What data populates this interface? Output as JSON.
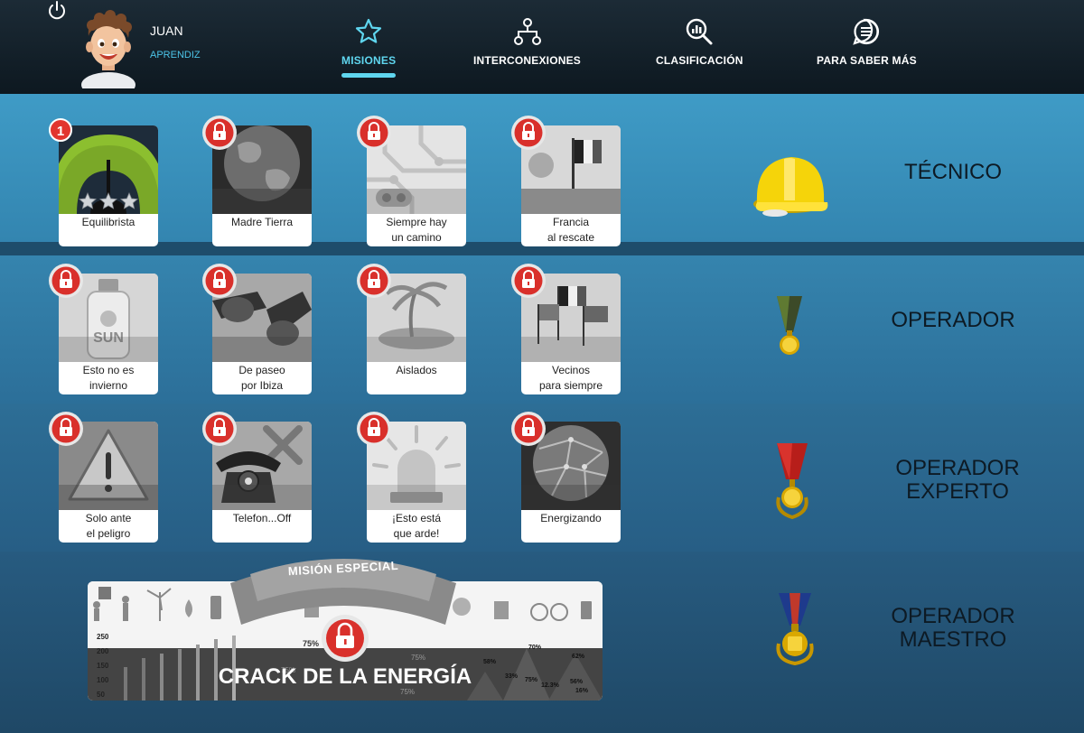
{
  "user": {
    "name": "JUAN",
    "rank": "APRENDIZ"
  },
  "tabs": [
    {
      "label": "MISIONES",
      "icon": "star-icon"
    },
    {
      "label": "INTERCONEXIONES",
      "icon": "network-icon"
    },
    {
      "label": "CLASIFICACIÓN",
      "icon": "ranking-search-icon"
    },
    {
      "label": "PARA SABER MÁS",
      "icon": "chat-list-icon"
    }
  ],
  "levels": [
    {
      "rank": [
        "TÉCNICO"
      ],
      "award": "helmet-icon",
      "missions": [
        {
          "line1": "Equilibrista",
          "line2": "",
          "locked": false,
          "badge": "1",
          "stars": 3
        },
        {
          "line1": "Madre Tierra",
          "line2": "",
          "locked": true
        },
        {
          "line1": "Siempre hay",
          "line2": "un camino",
          "locked": true
        },
        {
          "line1": "Francia",
          "line2": "al rescate",
          "locked": true
        }
      ]
    },
    {
      "rank": [
        "OPERADOR"
      ],
      "award": "green-medal-icon",
      "missions": [
        {
          "line1": "Esto no es",
          "line2": "invierno",
          "locked": true,
          "art_text": "SUN"
        },
        {
          "line1": "De paseo",
          "line2": "por Ibiza",
          "locked": true
        },
        {
          "line1": "Aislados",
          "line2": "",
          "locked": true
        },
        {
          "line1": "Vecinos",
          "line2": "para siempre",
          "locked": true
        }
      ]
    },
    {
      "rank": [
        "OPERADOR",
        "EXPERTO"
      ],
      "award": "red-medal-icon",
      "missions": [
        {
          "line1": "Solo ante",
          "line2": "el peligro",
          "locked": true
        },
        {
          "line1": "Telefon...Off",
          "line2": "",
          "locked": true
        },
        {
          "line1": "¡Esto está",
          "line2": "que arde!",
          "locked": true
        },
        {
          "line1": "Energizando",
          "line2": "",
          "locked": true
        }
      ]
    },
    {
      "rank": [
        "OPERADOR",
        "MAESTRO"
      ],
      "award": "blue-medal-icon"
    }
  ],
  "special": {
    "ribbon": "MISIÓN ESPECIAL",
    "title": "CRACK DE LA ENERGÍA",
    "axis_ticks": [
      "250",
      "200",
      "150",
      "100",
      "50"
    ],
    "percent_labels": [
      "75%",
      "75%",
      "75%",
      "75%",
      "70%",
      "62%",
      "58%",
      "33%",
      "75%",
      "12.3%",
      "56%",
      "16%"
    ]
  },
  "colors": {
    "accent": "#5fd6ef",
    "lock": "#d9302b",
    "badge": "#e2352f"
  }
}
